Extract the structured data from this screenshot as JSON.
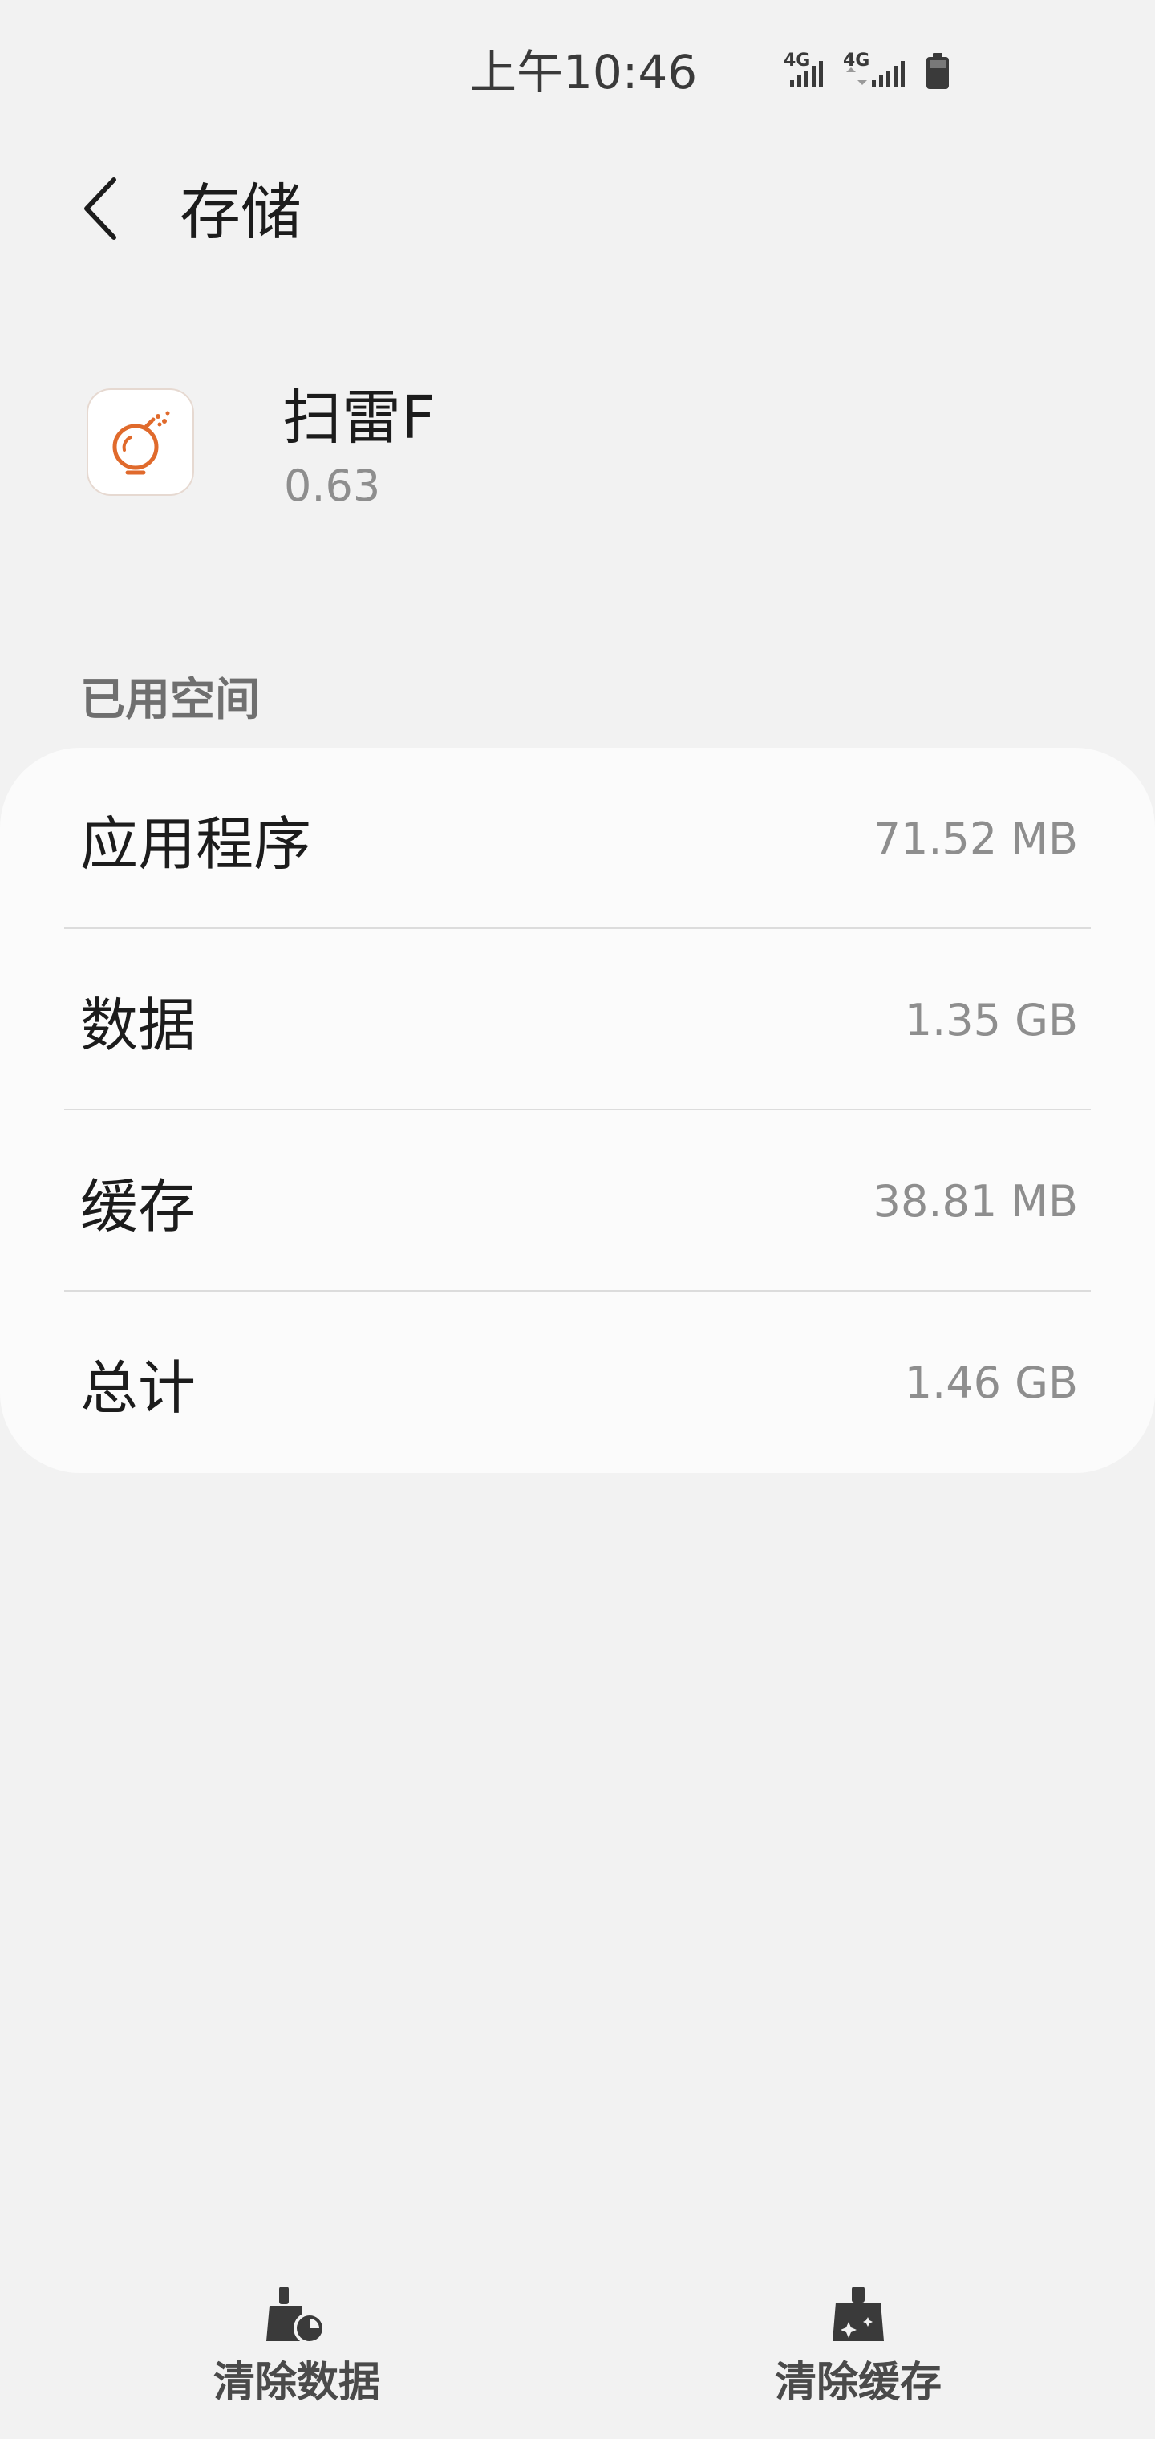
{
  "status_bar": {
    "time": "上午10:46",
    "network_1": "4G",
    "network_2": "4G",
    "icons": [
      "signal-icon",
      "signal-icon",
      "battery-icon"
    ]
  },
  "header": {
    "title": "存储",
    "back_icon": "chevron-left-icon"
  },
  "app": {
    "name": "扫雷F",
    "version": "0.63",
    "icon": "bomb-icon",
    "accent_color": "#e06a2c"
  },
  "storage": {
    "section_label": "已用空间",
    "rows": [
      {
        "label": "应用程序",
        "value": "71.52 MB"
      },
      {
        "label": "数据",
        "value": "1.35 GB"
      },
      {
        "label": "缓存",
        "value": "38.81 MB"
      },
      {
        "label": "总计",
        "value": "1.46 GB"
      }
    ]
  },
  "actions": {
    "clear_data_label": "清除数据",
    "clear_data_icon": "clear-data-icon",
    "clear_cache_label": "清除缓存",
    "clear_cache_icon": "clear-cache-icon"
  }
}
